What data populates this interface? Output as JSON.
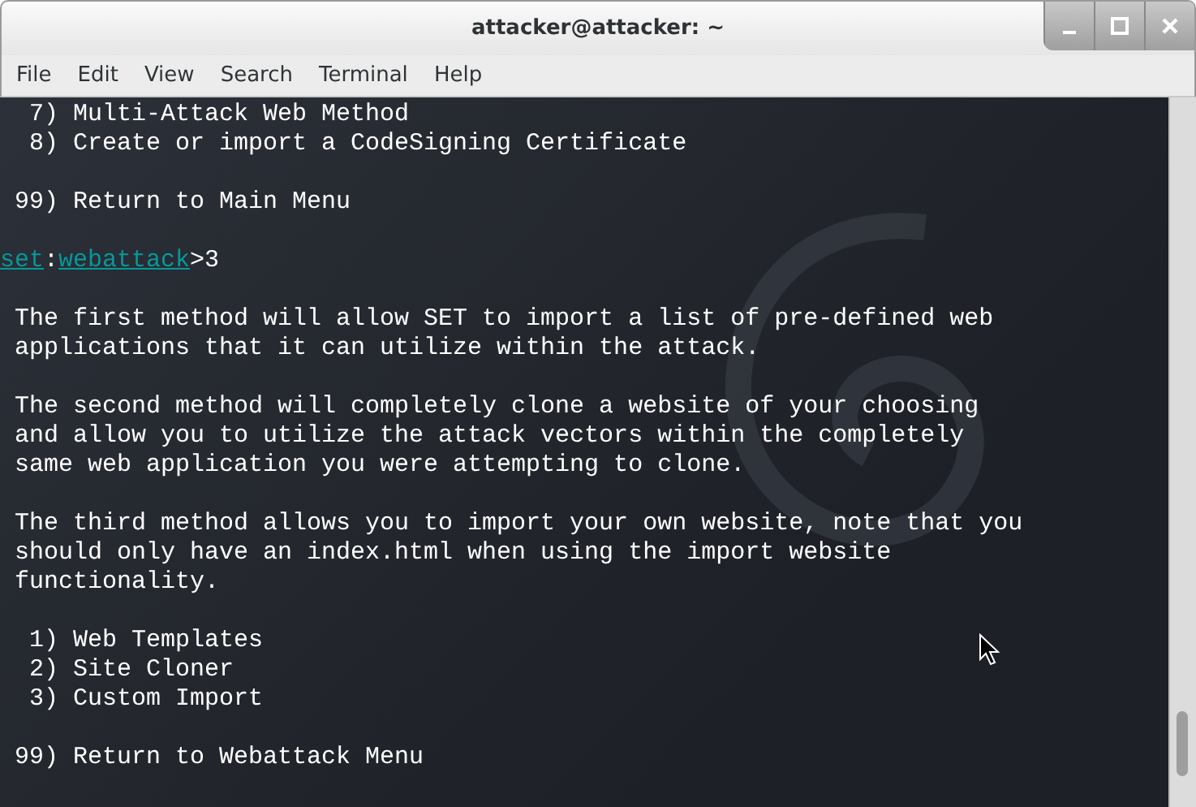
{
  "window": {
    "title": "attacker@attacker: ~"
  },
  "menu": [
    "File",
    "Edit",
    "View",
    "Search",
    "Terminal",
    "Help"
  ],
  "terminal": {
    "lines": [
      {
        "kind": "text",
        "text": "  7) Multi-Attack Web Method"
      },
      {
        "kind": "text",
        "text": "  8) Create or import a CodeSigning Certificate"
      },
      {
        "kind": "blank"
      },
      {
        "kind": "text",
        "text": " 99) Return to Main Menu"
      },
      {
        "kind": "blank"
      },
      {
        "kind": "prompt",
        "tool": "set",
        "separator": ":",
        "module": "webattack",
        "input": ">3"
      },
      {
        "kind": "blank"
      },
      {
        "kind": "text",
        "text": " The first method will allow SET to import a list of pre-defined web"
      },
      {
        "kind": "text",
        "text": " applications that it can utilize within the attack."
      },
      {
        "kind": "blank"
      },
      {
        "kind": "text",
        "text": " The second method will completely clone a website of your choosing"
      },
      {
        "kind": "text",
        "text": " and allow you to utilize the attack vectors within the completely"
      },
      {
        "kind": "text",
        "text": " same web application you were attempting to clone."
      },
      {
        "kind": "blank"
      },
      {
        "kind": "text",
        "text": " The third method allows you to import your own website, note that you"
      },
      {
        "kind": "text",
        "text": " should only have an index.html when using the import website"
      },
      {
        "kind": "text",
        "text": " functionality."
      },
      {
        "kind": "blank"
      },
      {
        "kind": "text",
        "text": "  1) Web Templates"
      },
      {
        "kind": "text",
        "text": "  2) Site Cloner"
      },
      {
        "kind": "text",
        "text": "  3) Custom Import"
      },
      {
        "kind": "blank"
      },
      {
        "kind": "text",
        "text": " 99) Return to Webattack Menu"
      }
    ]
  }
}
